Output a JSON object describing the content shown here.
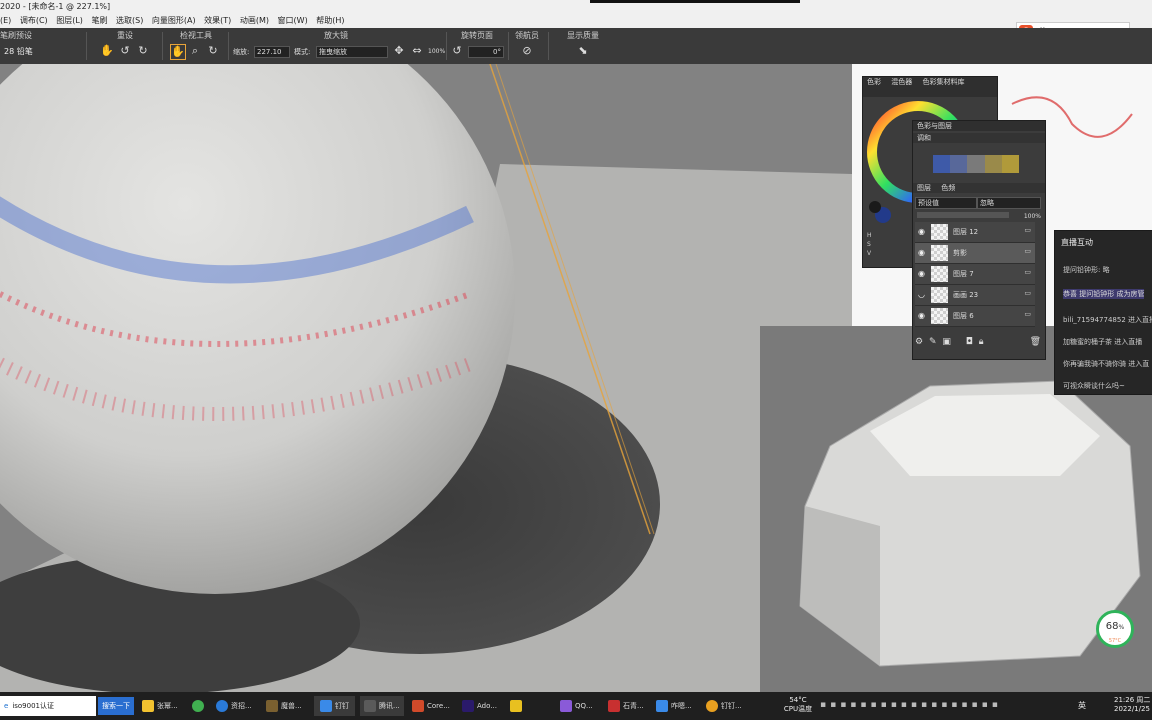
{
  "window": {
    "title": "2020 - [未命名-1 @ 227.1%]"
  },
  "menu": [
    "(E)",
    "调布(C)",
    "图层(L)",
    "笔刷",
    "选取(S)",
    "向量图形(A)",
    "效果(T)",
    "动画(M)",
    "窗口(W)",
    "帮助(H)"
  ],
  "toolbar": {
    "brush_group": {
      "label": "笔刷预设",
      "value": "28 铅笔"
    },
    "reset": {
      "label": "重设"
    },
    "view_tools": {
      "label": "检视工具"
    },
    "magnifier": {
      "label": "放大镜",
      "zoom_label": "缩放:",
      "zoom_value": "227.10",
      "mode_label": "模式:",
      "mode_value": "拖曳缩放",
      "percent": "100%"
    },
    "rotate": {
      "label": "旋转页面",
      "value": "0°"
    },
    "navigator": {
      "label": "领航员"
    },
    "display_quality": {
      "label": "显示质量"
    }
  },
  "ime": {
    "text": "英"
  },
  "panels": {
    "color": {
      "tabs": [
        "色彩",
        "混色器",
        "色彩集材料库"
      ],
      "hsv": [
        "H",
        "S",
        "V"
      ]
    },
    "color_layers": {
      "title": "色彩与图层",
      "subtitle": "调和"
    },
    "layers": {
      "tabs": [
        "图层",
        "色频"
      ],
      "blend": "预设值",
      "composite": "忽略",
      "opacity": "100%",
      "rows": [
        {
          "name": "图层 12",
          "selected": false
        },
        {
          "name": "剪影",
          "selected": true
        },
        {
          "name": "图层 7",
          "selected": false
        },
        {
          "name": "画画 23",
          "selected": false
        },
        {
          "name": "图层 6",
          "selected": false
        }
      ]
    }
  },
  "chat": {
    "title": "直播互动",
    "messages": [
      "提问铅钟形: 略",
      "恭喜 提问铅钟形 成为房管",
      "bili_71594774852 进入直播",
      "加糖蜜的桶子茶 进入直播",
      "你再骗我骑不骑你骑 进入直",
      "可视众瞬谈什么吗~"
    ]
  },
  "taskbar": {
    "search_placeholder": "iso9001认证",
    "search_button": "搜索一下",
    "items": [
      "张幂...",
      "",
      "资招...",
      "魔兽...",
      "钉钉",
      "腾讯...",
      "Core...",
      "Ado...",
      "",
      "QQ...",
      "石青...",
      "咋嗯...",
      "钉钉..."
    ],
    "temp": "54°C",
    "cpu_label": "CPU温度",
    "lang": "英",
    "time": "21:26 周二",
    "date": "2022/1/25"
  },
  "gauge": {
    "value": "68",
    "unit": "%",
    "temp": "57°C"
  },
  "colors": {
    "accent": "#e8a43a",
    "green": "#2fb35a"
  }
}
